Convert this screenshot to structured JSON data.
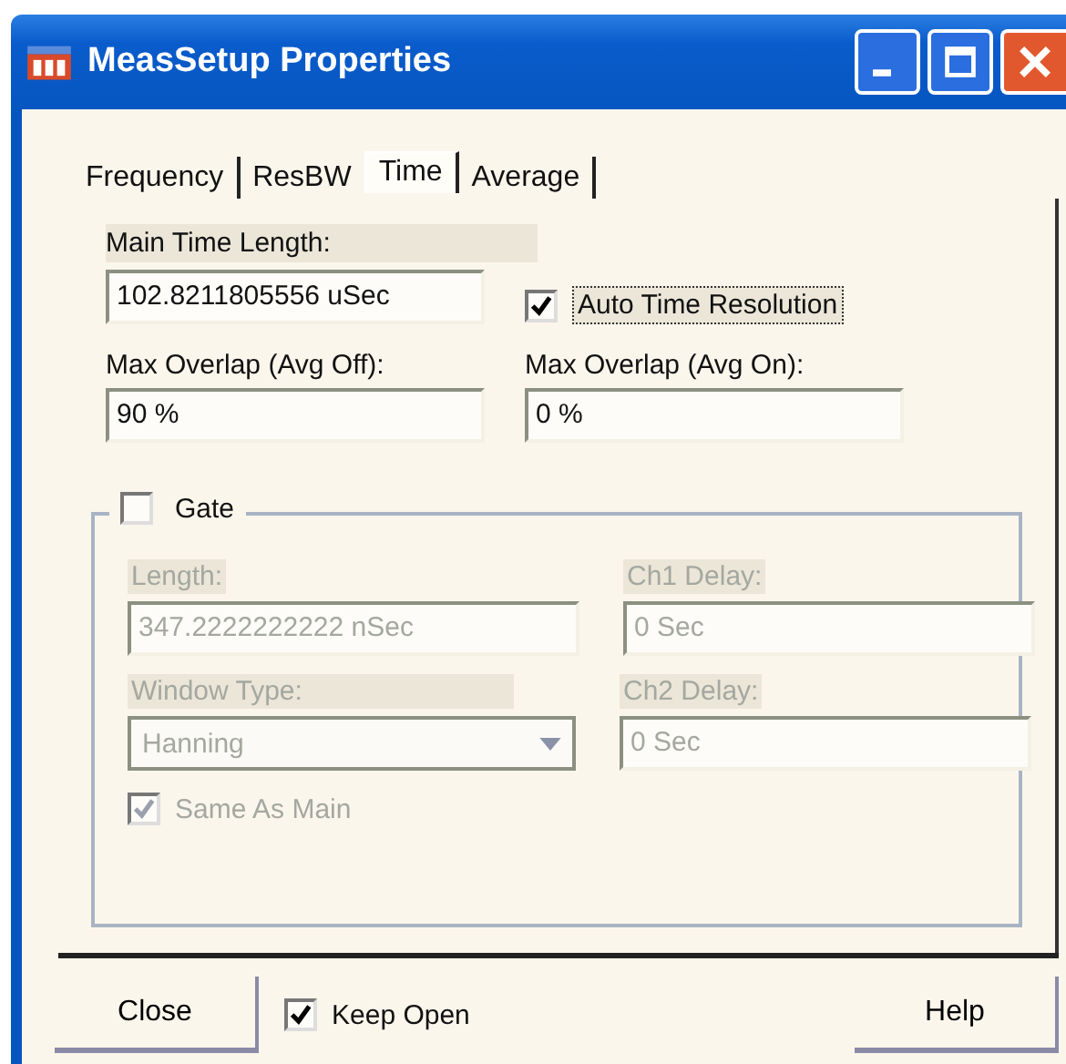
{
  "window": {
    "title": "MeasSetup Properties"
  },
  "tabs": [
    {
      "label": "Frequency",
      "selected": false
    },
    {
      "label": "ResBW",
      "selected": false
    },
    {
      "label": "Time",
      "selected": true
    },
    {
      "label": "Average",
      "selected": false
    }
  ],
  "main_time_length": {
    "label": "Main Time Length:",
    "value": "102.8211805556 uSec"
  },
  "auto_time_resolution": {
    "label": "Auto Time Resolution",
    "checked": true
  },
  "max_overlap_avg_off": {
    "label": "Max Overlap (Avg Off):",
    "value": "90 %"
  },
  "max_overlap_avg_on": {
    "label": "Max Overlap (Avg On):",
    "value": "0 %"
  },
  "gate": {
    "label": "Gate",
    "checked": false,
    "length": {
      "label": "Length:",
      "value": "347.2222222222 nSec",
      "disabled": true
    },
    "ch1_delay": {
      "label": "Ch1 Delay:",
      "value": "0 Sec",
      "disabled": true
    },
    "window_type": {
      "label": "Window Type:",
      "value": "Hanning",
      "disabled": true
    },
    "ch2_delay": {
      "label": "Ch2 Delay:",
      "value": "0 Sec",
      "disabled": true
    },
    "same_as_main": {
      "label": "Same As Main",
      "checked": true,
      "disabled": true
    }
  },
  "footer": {
    "close": "Close",
    "keep_open": {
      "label": "Keep Open",
      "checked": true
    },
    "help": "Help"
  }
}
